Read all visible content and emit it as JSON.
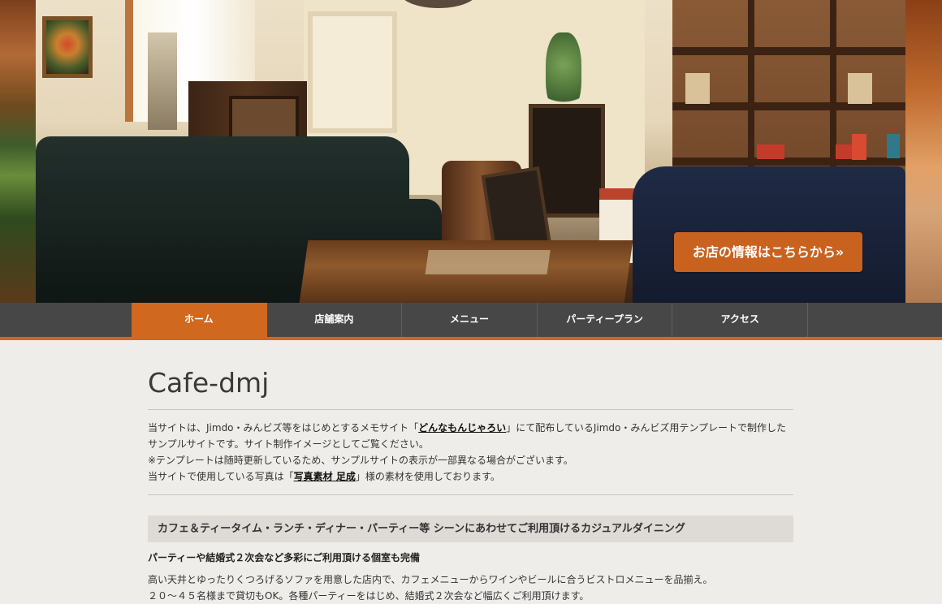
{
  "hero": {
    "cta_label": "お店の情報はこちらから»"
  },
  "nav": {
    "items": [
      {
        "label": "ホーム",
        "active": true
      },
      {
        "label": "店舗案内",
        "active": false
      },
      {
        "label": "メニュー",
        "active": false
      },
      {
        "label": "パーティープラン",
        "active": false
      },
      {
        "label": "アクセス",
        "active": false
      }
    ]
  },
  "content": {
    "title": "Cafe-dmj",
    "intro": {
      "line1_before": "当サイトは、Jimdo・みんビズ等をはじめとするメモサイト「",
      "link1": "どんなもんじゃろい",
      "line1_after": "」にて配布しているJimdo・みんビズ用テンプレートで制作したサンプルサイトです。サイト制作イメージとしてご覧ください。",
      "line2": "※テンプレートは随時更新しているため、サンプルサイトの表示が一部異なる場合がございます。",
      "line3_before": "当サイトで使用している写真は「",
      "link2": "写真素材 足成",
      "line3_after": "」様の素材を使用しております。"
    },
    "section_heading": "カフェ＆ティータイム・ランチ・ディナー・パーティー等 シーンにあわせてご利用頂けるカジュアルダイニング",
    "sub_heading": "パーティーや結婚式２次会など多彩にご利用頂ける個室も完備",
    "body_line1": "高い天井とゆったりくつろげるソファを用意した店内で、カフェメニューからワインやビールに合うビストロメニューを品揃え。",
    "body_line2": "２０～４５名様まで貸切もOK。各種パーティーをはじめ、結婚式２次会など幅広くご利用頂けます。"
  },
  "colors": {
    "accent": "#d0691f",
    "nav_bg": "#474747",
    "page_bg": "#efedea",
    "section_bg": "#dedbd6"
  }
}
